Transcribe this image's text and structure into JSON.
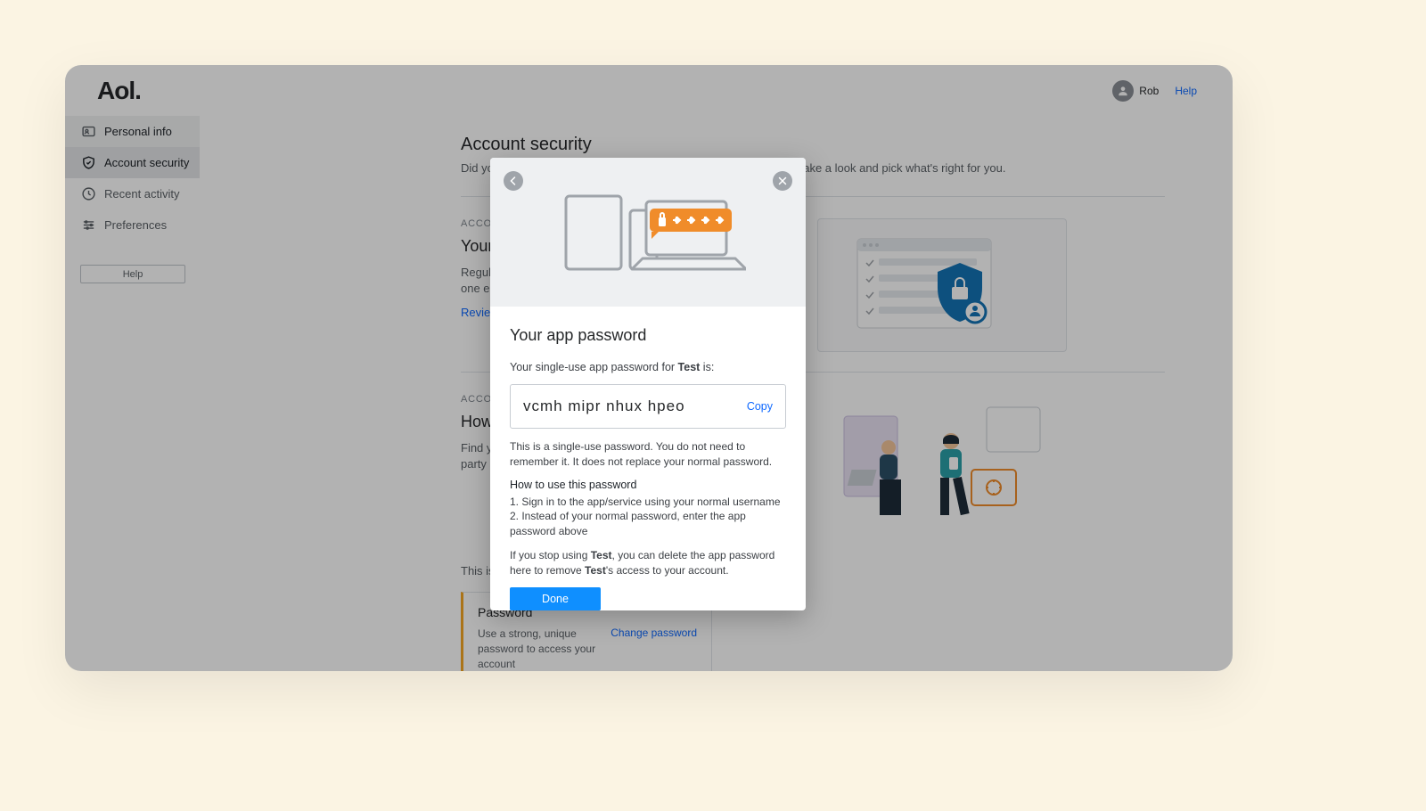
{
  "header": {
    "logo": "Aol.",
    "user_name": "Rob",
    "help": "Help"
  },
  "sidebar": {
    "items": [
      {
        "label": "Personal info"
      },
      {
        "label": "Account security"
      },
      {
        "label": "Recent activity"
      },
      {
        "label": "Preferences"
      }
    ],
    "help_button": "Help"
  },
  "page": {
    "title": "Account security",
    "subtitle": "Did you know your account has its own unique protection needs? Take a look and pick what's right for you."
  },
  "section1": {
    "eyebrow": "ACCOUNT ACTIVITY",
    "title": "Your account has no unusual issues",
    "body": "Regularly check your account activity to make sure no one else has access.",
    "link": "Review recent activity"
  },
  "section2": {
    "eyebrow": "ACCOUNT ACCESS",
    "title": "How you sign in",
    "body": "Find your password and the apps, devices, and third-party services that you gave access to."
  },
  "section3": {
    "lead": "This is how you can sign in to your account."
  },
  "password_card": {
    "title": "Password",
    "text": "Use a strong, unique password to access your account",
    "link": "Change password"
  },
  "modal": {
    "title": "Your app password",
    "lead_pre": "Your single-use app password for ",
    "app_name": "Test",
    "lead_post": " is:",
    "password": "vcmh  mipr  nhux  hpeo",
    "copy": "Copy",
    "note": "This is a single-use password. You do not need to remember it. It does not replace your normal password.",
    "howto_title": "How to use this password",
    "steps": [
      "1. Sign in to the app/service using your normal username",
      "2. Instead of your normal password, enter the app password above"
    ],
    "trail_pre": "If you stop using ",
    "trail_mid": ", you can delete the app password here to remove ",
    "trail_post": "'s access to your account.",
    "done": "Done"
  }
}
